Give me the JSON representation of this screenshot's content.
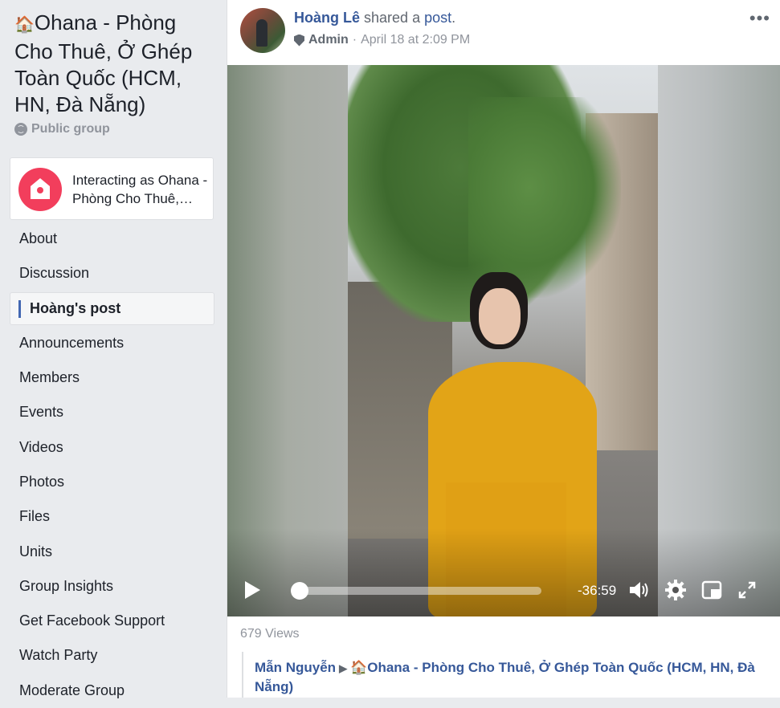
{
  "sidebar": {
    "group_icon": "🏠",
    "group_name": "Ohana - Phòng Cho Thuê, Ở Ghép Toàn Quốc (HCM, HN, Đà Nẵng)",
    "privacy_label": "Public group",
    "interacting_as": "Interacting as Ohana - Phòng Cho Thuê,…",
    "nav_items": [
      {
        "label": "About"
      },
      {
        "label": "Discussion"
      },
      {
        "label": "Hoàng's post",
        "active": true
      },
      {
        "label": "Announcements"
      },
      {
        "label": "Members"
      },
      {
        "label": "Events"
      },
      {
        "label": "Videos"
      },
      {
        "label": "Photos"
      },
      {
        "label": "Files"
      },
      {
        "label": "Units"
      },
      {
        "label": "Group Insights"
      },
      {
        "label": "Get Facebook Support"
      },
      {
        "label": "Watch Party"
      },
      {
        "label": "Moderate Group"
      }
    ]
  },
  "post": {
    "author": "Hoàng Lê",
    "action": "shared a",
    "object": "post",
    "role": "Admin",
    "timestamp": "April 18 at 2:09 PM",
    "more_label": "•••"
  },
  "video": {
    "time_remaining": "-36:59",
    "progress": 0.0,
    "icons": [
      "play-icon",
      "volume-icon",
      "gear-icon",
      "picture-in-picture-icon",
      "fullscreen-icon"
    ]
  },
  "views_label": "679 Views",
  "shared_from": {
    "original_author": "Mẫn Nguyễn",
    "group_icon": "🏠",
    "group_name": "Ohana - Phòng Cho Thuê, Ở Ghép Toàn Quốc (HCM, HN, Đà Nẵng)"
  },
  "colors": {
    "link": "#365899",
    "background": "#e9ebee",
    "accent": "#4267b2",
    "avatar_red": "#f23e5c"
  }
}
